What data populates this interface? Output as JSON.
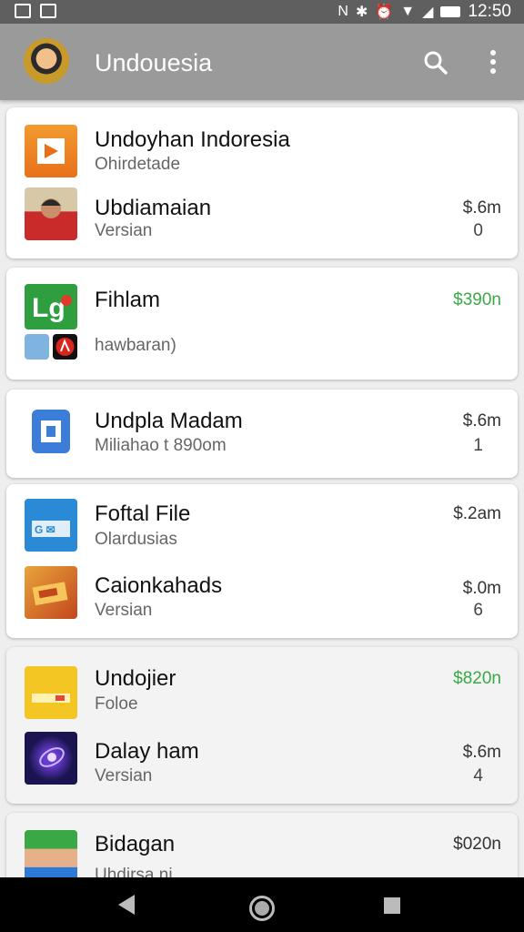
{
  "status_bar": {
    "time": "12:50"
  },
  "app_bar": {
    "title": "Undouesia"
  },
  "cards": [
    {
      "rows": [
        {
          "title": "Undoyhan Indoresia",
          "subtitle": "Ohirdetade",
          "amount": "",
          "count": ""
        },
        {
          "title": "Ubdiamaian",
          "subtitle": "Versian",
          "amount": "$.6m",
          "count": "0"
        }
      ]
    },
    {
      "rows": [
        {
          "title": "Fihlam",
          "subtitle": "hawbaran)",
          "amount": "$390n",
          "count": ""
        }
      ]
    },
    {
      "rows": [
        {
          "title": "Undpla Madam",
          "subtitle": "Miliahao t 890om",
          "amount": "$.6m",
          "count": "1"
        }
      ]
    },
    {
      "rows": [
        {
          "title": "Foftal File",
          "subtitle": "Olardusias",
          "amount": "$.2am",
          "count": ""
        },
        {
          "title": "Caionkahads",
          "subtitle": "Versian",
          "amount": "$.0m",
          "count": "6"
        }
      ]
    },
    {
      "rows": [
        {
          "title": "Undojier",
          "subtitle": "Foloe",
          "amount": "$820n",
          "count": ""
        },
        {
          "title": "Dalay ham",
          "subtitle": "Versian",
          "amount": "$.6m",
          "count": "4"
        }
      ]
    },
    {
      "rows": [
        {
          "title": "Bidagan",
          "subtitle": "Uhdirsa ni",
          "amount": "$020n",
          "count": ""
        }
      ]
    }
  ],
  "colors": {
    "accent_green": "#3aa845",
    "app_bar": "#9a9a9a",
    "status_bar": "#5f5f5f"
  },
  "icons": [
    "search-icon",
    "more-vert-icon",
    "back-icon",
    "home-icon",
    "recents-icon"
  ]
}
